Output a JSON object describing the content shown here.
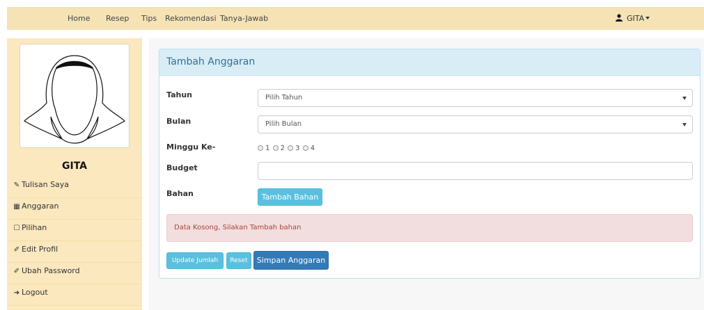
{
  "navbar": {
    "items": [
      {
        "label": "Home"
      },
      {
        "label": "Resep"
      },
      {
        "label": "Tips"
      },
      {
        "label": "Rekomendasi"
      },
      {
        "label": "Tanya-Jawab"
      }
    ],
    "user": {
      "label": "GITA",
      "icon": "user-icon"
    }
  },
  "sidebar": {
    "avatar_icon": "hijab-avatar-icon",
    "name": "GITA",
    "items": [
      {
        "label": "Tulisan Saya",
        "icon": "edit-icon"
      },
      {
        "label": "Anggaran",
        "icon": "calculator-icon"
      },
      {
        "label": "Pilihan",
        "icon": "bookmark-icon"
      },
      {
        "label": "Edit Profil",
        "icon": "pencil-icon"
      },
      {
        "label": "Ubah Password",
        "icon": "pencil-icon"
      },
      {
        "label": "Logout",
        "icon": "logout-icon"
      }
    ]
  },
  "panel": {
    "title": "Tambah Anggaran",
    "form": {
      "tahun": {
        "label": "Tahun",
        "value": "Pilih Tahun"
      },
      "bulan": {
        "label": "Bulan",
        "value": "Pilih Bulan"
      },
      "minggu": {
        "label": "Minggu Ke-",
        "options": [
          "1",
          "2",
          "3",
          "4"
        ]
      },
      "budget": {
        "label": "Budget",
        "value": ""
      },
      "bahan": {
        "label": "Bahan",
        "button": "Tambah Bahan"
      }
    },
    "alert": "Data Kosong, Silakan Tambah bahan",
    "actions": {
      "update": "Update Jumlah",
      "reset": "Reset",
      "save": "Simpan Anggaran"
    }
  },
  "colors": {
    "navbar_bg": "#f5e3b5",
    "sidebar_bg": "#fbe8bf",
    "panel_heading_bg": "#d9edf7",
    "info_button": "#5bc0de",
    "primary_button": "#337ab7",
    "alert_bg": "#f2dede"
  }
}
